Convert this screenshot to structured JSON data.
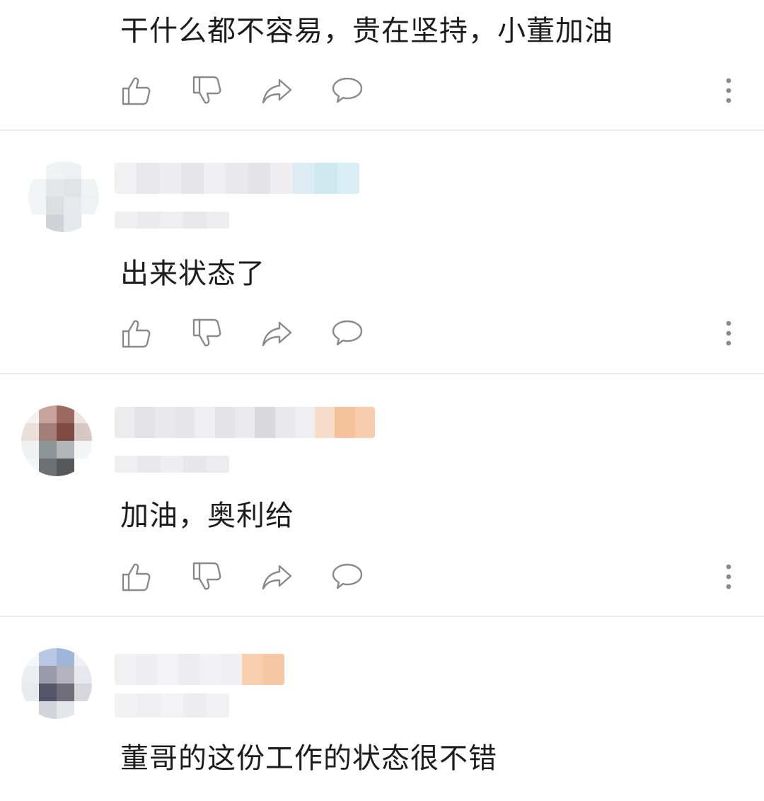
{
  "comments": [
    {
      "text": "干什么都不容易，贵在坚持，小董加油"
    },
    {
      "text": "出来状态了"
    },
    {
      "text": "加油，奥利给"
    },
    {
      "text": "董哥的这份工作的状态很不错"
    }
  ],
  "icons": {
    "like": "thumbs-up-icon",
    "dislike": "thumbs-down-icon",
    "share": "share-arrow-icon",
    "reply": "speech-bubble-icon",
    "more": "more-vertical-icon"
  },
  "colors": {
    "icon_stroke": "#8a8a8a",
    "divider": "#ececec",
    "text": "#1c1c1c"
  }
}
